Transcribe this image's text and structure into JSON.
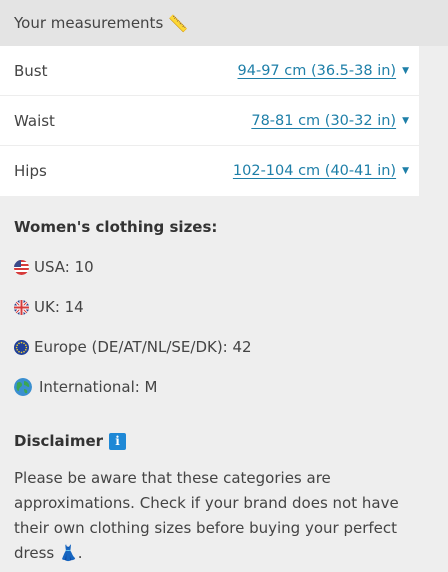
{
  "header": {
    "title": "Your measurements",
    "icon": "ruler-icon"
  },
  "measurements": [
    {
      "label": "Bust",
      "value": "94-97 cm (36.5-38 in)"
    },
    {
      "label": "Waist",
      "value": "78-81 cm (30-32 in)"
    },
    {
      "label": "Hips",
      "value": "102-104 cm (40-41 in)"
    }
  ],
  "sizes": {
    "title": "Women's clothing sizes:",
    "usa": "USA: 10",
    "uk": "UK: 14",
    "europe": "Europe (DE/AT/NL/SE/DK): 42",
    "international": "International: M"
  },
  "disclaimer": {
    "title": "Disclaimer",
    "text": "Please be aware that these categories are approximations. Check if your brand does not have their own clothing sizes before buying your perfect dress"
  },
  "colors": {
    "link": "#1e7fa8",
    "info_icon": "#1e88d6",
    "header_bg": "#e4e4e4",
    "page_bg": "#eeeeee"
  }
}
